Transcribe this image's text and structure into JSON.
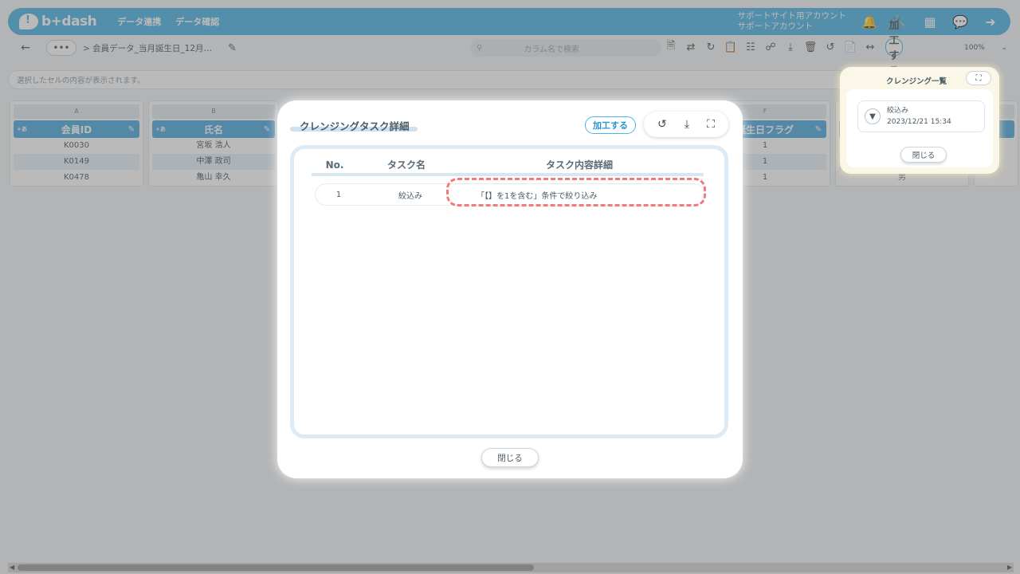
{
  "header": {
    "logo": "b+dash",
    "nav": [
      "データ連携",
      "データ確認"
    ],
    "account_line1": "サポートサイト用アカウント",
    "account_line2": "サポートアカウント",
    "icons": [
      "bell-icon",
      "wrench-icon",
      "apps-grid-icon",
      "chat-icon",
      "logout-icon"
    ]
  },
  "toolbar": {
    "breadcrumb_more": "•••",
    "breadcrumb": "> 会員データ_当月誕生日_12月…",
    "search_placeholder": "カラム名で検索",
    "process_label": "加工する",
    "zoom": "100%"
  },
  "infobar": {
    "text": "選択したセルの内容が表示されます。"
  },
  "grid": {
    "columns": [
      {
        "letter": "A",
        "name": "会員ID",
        "type": "+あ",
        "cells": [
          "K0030",
          "K0149",
          "K0478"
        ]
      },
      {
        "letter": "B",
        "name": "氏名",
        "type": "+あ",
        "cells": [
          "宮坂 浩人",
          "中澤 政司",
          "亀山 幸久"
        ]
      },
      {
        "letter": "F",
        "name": "誕生日フラグ",
        "type": "",
        "cells": [
          "1",
          "1",
          "1"
        ]
      },
      {
        "letter": "",
        "name": "",
        "type": "",
        "cells": [
          "",
          "",
          "男"
        ]
      }
    ]
  },
  "cleansing_panel": {
    "title": "クレンジング一覧",
    "task_name": "絞込み",
    "task_date": "2023/12/21 15:34",
    "close_label": "閉じる"
  },
  "modal": {
    "title": "クレンジングタスク詳細",
    "process_label": "加工する",
    "headers": {
      "no": "No.",
      "name": "タスク名",
      "detail": "タスク内容詳細"
    },
    "rows": [
      {
        "no": "1",
        "name": "絞込み",
        "detail": "「【】を1を含む」条件で絞り込み"
      }
    ],
    "close_label": "閉じる"
  }
}
